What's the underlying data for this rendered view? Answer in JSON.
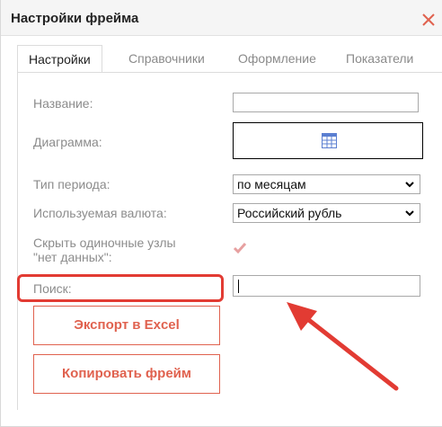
{
  "window": {
    "title": "Настройки фрейма",
    "close_icon": "close-icon"
  },
  "tabs": [
    {
      "label": "Настройки",
      "active": true
    },
    {
      "label": "Справочники",
      "active": false
    },
    {
      "label": "Оформление",
      "active": false
    },
    {
      "label": "Показатели",
      "active": false
    }
  ],
  "form": {
    "name_label": "Название:",
    "name_value": "",
    "diagram_label": "Диаграмма:",
    "diagram_icon": "table-icon",
    "period_label": "Тип периода:",
    "period_value": "по месяцам",
    "currency_label": "Используемая валюта:",
    "currency_value": "Российский рубль",
    "hide_nodes_label_line1": "Скрыть одиночные узлы",
    "hide_nodes_label_line2": "\"нет данных\":",
    "hide_nodes_checked": true,
    "search_label": "Поиск:",
    "search_value": ""
  },
  "buttons": {
    "export_label": "Экспорт в Excel",
    "copy_label": "Копировать фрейм"
  },
  "colors": {
    "accent": "#e0624f",
    "highlight": "#e23b33",
    "close": "#e0624f"
  }
}
